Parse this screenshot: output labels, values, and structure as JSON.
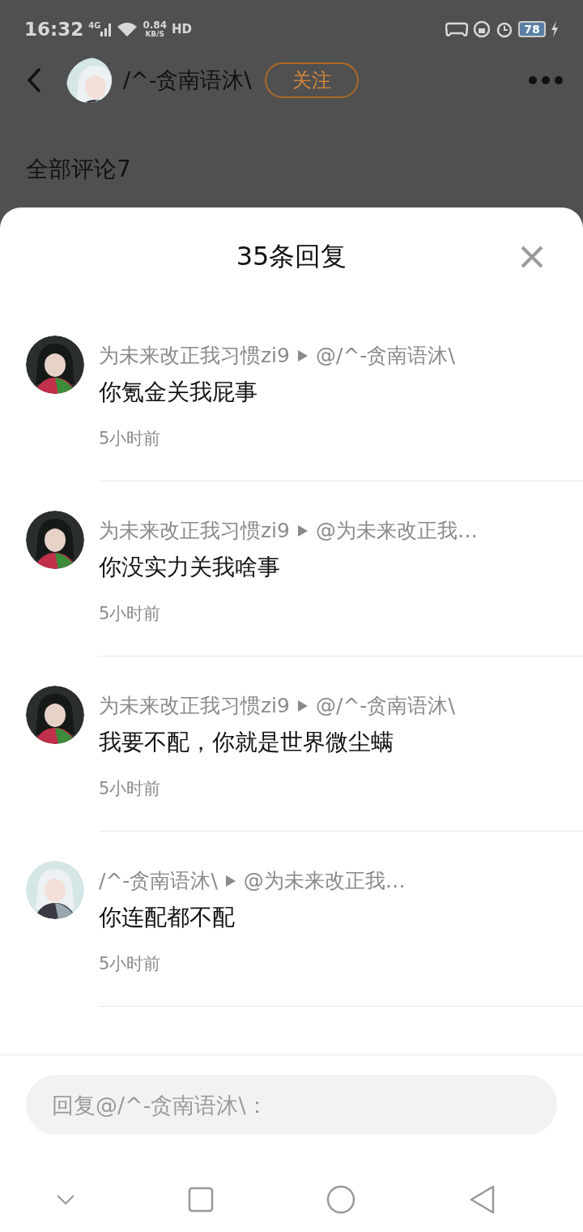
{
  "status_bar": {
    "time": "16:32",
    "network": "4G",
    "speed": "0.84",
    "speed_unit": "KB/S",
    "hd": "HD",
    "battery": "78"
  },
  "header": {
    "username": "/^-贪南语沐\\",
    "follow_button": "关注"
  },
  "comments_heading": "全部评论7",
  "sheet": {
    "title": "35条回复",
    "replies": [
      {
        "author": "为未来改正我习惯zi9",
        "reply_to": "@/^-贪南语沐\\",
        "content": "你氪金关我屁事",
        "time": "5小时前",
        "kind": "dark"
      },
      {
        "author": "为未来改正我习惯zi9",
        "reply_to": "@为未来改正我…",
        "content": "你没实力关我啥事",
        "time": "5小时前",
        "kind": "dark"
      },
      {
        "author": "为未来改正我习惯zi9",
        "reply_to": "@/^-贪南语沐\\",
        "content": "我要不配，你就是世界微尘螨",
        "time": "5小时前",
        "kind": "dark"
      },
      {
        "author": "/^-贪南语沐\\",
        "reply_to": "@为未来改正我…",
        "content": "你连配都不配",
        "time": "5小时前",
        "kind": "light"
      }
    ]
  },
  "reply_field": {
    "placeholder": "回复@/^-贪南语沐\\："
  }
}
